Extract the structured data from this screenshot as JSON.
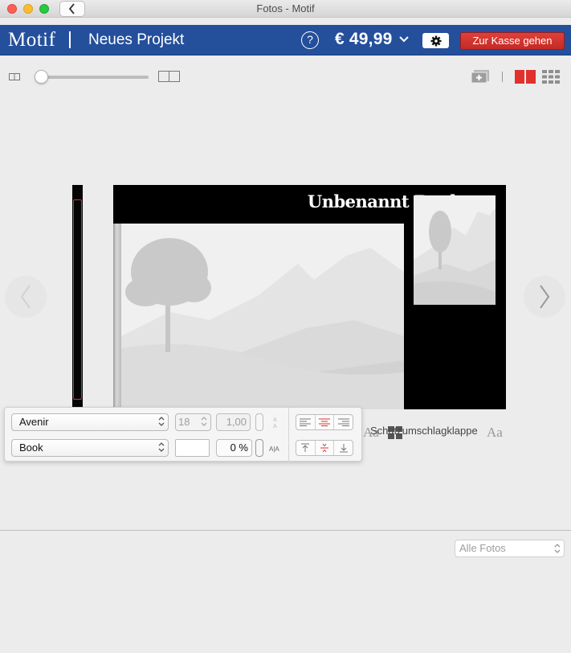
{
  "window": {
    "title": "Fotos - Motif"
  },
  "header": {
    "brand": "Motif",
    "project": "Neues Projekt",
    "help": "?",
    "price": "€ 49,99",
    "checkout_label": "Zur Kasse gehen",
    "colors": {
      "bar": "#244f9b",
      "checkout": "#d0322c"
    }
  },
  "toolbar": {
    "zoom_level": 0.05,
    "active_view": "spread",
    "active_color": "#e0312d"
  },
  "book": {
    "title": "Unbenannt Buch",
    "label": "Schutzumschlagklappe",
    "font_glyph": "Aa"
  },
  "format": {
    "font_family": "Avenir",
    "font_style": "Book",
    "font_size": "18",
    "line_spacing": "1,00",
    "tracking": "0 %"
  },
  "photos": {
    "filter": "Alle Fotos"
  }
}
